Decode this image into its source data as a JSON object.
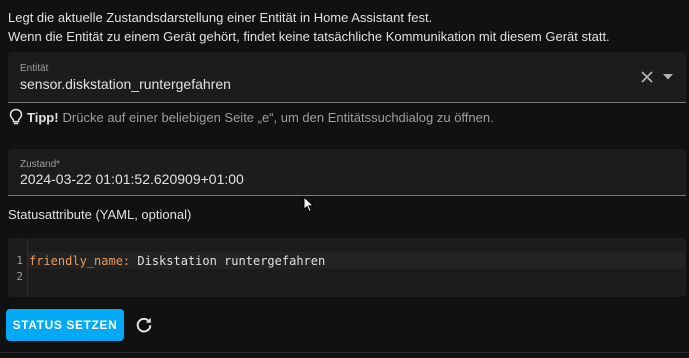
{
  "description": {
    "line1": "Legt die aktuelle Zustandsdarstellung einer Entität in Home Assistant fest.",
    "line2": "Wenn die Entität zu einem Gerät gehört, findet keine tatsächliche Kommunikation mit diesem Gerät statt."
  },
  "entity_field": {
    "label": "Entität",
    "value": "sensor.diskstation_runtergefahren",
    "clear_icon": "close-icon",
    "dropdown_icon": "menu-down-icon"
  },
  "tip": {
    "icon": "lightbulb-icon",
    "title": "Tipp!",
    "text": "Drücke auf einer beliebigen Seite „e“, um den Entitätssuchdialog zu öffnen."
  },
  "state_field": {
    "label": "Zustand*",
    "value": "2024-03-22 01:01:52.620909+01:00"
  },
  "attributes": {
    "title": "Statusattribute (YAML, optional)",
    "line_numbers": [
      "1",
      "2"
    ],
    "code_key": "friendly_name:",
    "code_value": " Diskstation runtergefahren"
  },
  "actions": {
    "set_state_label": "STATUS SETZEN",
    "refresh_icon": "refresh-icon"
  },
  "colors": {
    "background": "#111111",
    "field_background": "#1c1c1c",
    "primary": "#03a9f4",
    "yaml_key": "#e99a5e"
  }
}
